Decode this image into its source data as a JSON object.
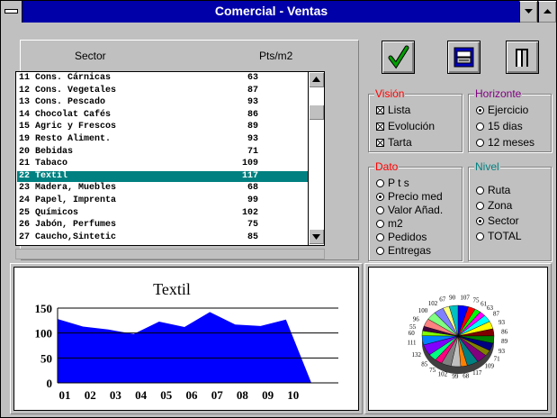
{
  "window": {
    "title": "Comercial - Ventas"
  },
  "list": {
    "header_sector": "Sector",
    "header_pts": "Pts/m2",
    "rows": [
      {
        "label": "11 Cons. Cárnicas",
        "value": "63"
      },
      {
        "label": "12 Cons. Vegetales",
        "value": "87"
      },
      {
        "label": "13 Cons. Pescado",
        "value": "93"
      },
      {
        "label": "14 Chocolat Cafés",
        "value": "86"
      },
      {
        "label": "15 Agric y Frescos",
        "value": "89"
      },
      {
        "label": "19 Resto Aliment.",
        "value": "93"
      },
      {
        "label": "20 Bebidas",
        "value": "71"
      },
      {
        "label": "21 Tabaco",
        "value": "109"
      },
      {
        "label": "22 Textil",
        "value": "117"
      },
      {
        "label": "23 Madera, Muebles",
        "value": "68"
      },
      {
        "label": "24 Papel, Imprenta",
        "value": "99"
      },
      {
        "label": "25 Químicos",
        "value": "102"
      },
      {
        "label": "26 Jabón, Perfumes",
        "value": "75"
      },
      {
        "label": "27 Caucho,Sintetic",
        "value": "85"
      }
    ],
    "selected_index": 8
  },
  "toolbar": {
    "ok_icon": "checkmark-icon",
    "print_icon": "printer-icon",
    "exit_icon": "door-exit-icon"
  },
  "vision": {
    "label": "Visión",
    "label_color": "#ff0000",
    "options": [
      "Lista",
      "Evolución",
      "Tarta"
    ],
    "checked": [
      true,
      true,
      true
    ]
  },
  "horizonte": {
    "label": "Horizonte",
    "label_color": "#800080",
    "options": [
      "Ejercicio",
      "15 dias",
      "12 meses"
    ],
    "selected": 0
  },
  "dato": {
    "label": "Dato",
    "label_color": "#ff0000",
    "options": [
      "P t s",
      "Precio med",
      "Valor Añad.",
      "m2",
      "Pedidos",
      "Entregas"
    ],
    "selected": 1
  },
  "nivel": {
    "label": "Nivel",
    "label_color": "#008080",
    "options": [
      "Ruta",
      "Zona",
      "Sector",
      "TOTAL"
    ],
    "selected": 2
  },
  "chart_data": [
    {
      "type": "area",
      "title": "Textil",
      "categories": [
        "01",
        "02",
        "03",
        "04",
        "05",
        "06",
        "07",
        "08",
        "09",
        "10"
      ],
      "values": [
        128,
        113,
        107,
        98,
        123,
        112,
        142,
        117,
        114,
        127,
        0
      ],
      "yticks": [
        "0",
        "50",
        "100",
        "150"
      ],
      "ylim": [
        0,
        150
      ],
      "color": "#0000ff"
    },
    {
      "type": "pie",
      "labels": [
        "107",
        "75",
        "61",
        "63",
        "87",
        "93",
        "86",
        "89",
        "93",
        "71",
        "109",
        "117",
        "68",
        "99",
        "102",
        "75",
        "85",
        "132",
        "111",
        "60",
        "55",
        "96",
        "100",
        "102",
        "67",
        "90"
      ],
      "values": [
        107,
        75,
        61,
        63,
        87,
        93,
        86,
        89,
        93,
        71,
        109,
        117,
        68,
        99,
        102,
        75,
        85,
        132,
        111,
        60,
        55,
        96,
        100,
        102,
        67,
        90
      ],
      "colors": [
        "#0000ff",
        "#ff0000",
        "#00ff00",
        "#ff00ff",
        "#00ffff",
        "#ffff00",
        "#800000",
        "#008000",
        "#000080",
        "#808000",
        "#800080",
        "#008080",
        "#ff8000",
        "#c0c0c0",
        "#808080",
        "#ff0080",
        "#00ff80",
        "#8000ff",
        "#0080ff",
        "#80ff00",
        "#400040",
        "#ff8080",
        "#80ff80",
        "#8080ff",
        "#ffff80",
        "#00c0c0"
      ]
    }
  ]
}
